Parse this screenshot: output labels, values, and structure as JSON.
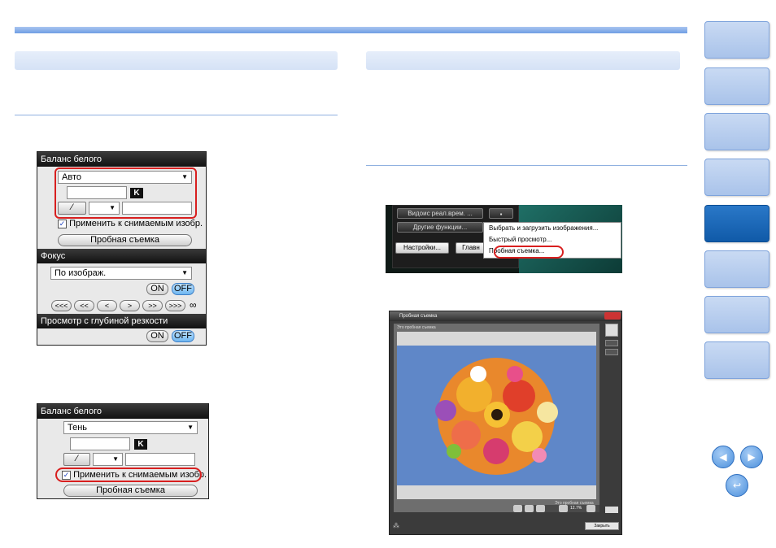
{
  "nav_tabs": [
    "",
    "",
    "",
    "",
    "",
    "",
    "",
    ""
  ],
  "panel1": {
    "wb_header": "Баланс белого",
    "wb_select": "Авто",
    "k_label": "K",
    "apply_label": "Применить к снимаемым изобр.",
    "test_shot": "Пробная съемка",
    "focus_header": "Фокус",
    "focus_select": "По изображ.",
    "on": "ON",
    "off": "OFF",
    "focus_nav": [
      "<<<",
      "<<",
      "<",
      ">",
      ">>",
      ">>>"
    ],
    "infinity": "∞",
    "dof_header": "Просмотр с глубиной резкости"
  },
  "panel2": {
    "wb_header": "Баланс белого",
    "wb_select": "Тень",
    "k_label": "K",
    "apply_label": "Применить к снимаемым изобр.",
    "test_shot": "Пробная съемка"
  },
  "menu_shot": {
    "btn_live_view": "Видоис реал.врем. ...",
    "btn_other": "Другие функции...",
    "btn_settings": "Настройки...",
    "btn_main": "Главн",
    "items": [
      "Выбрать и загрузить изображения...",
      "Быстрый просмотр...",
      "Пробная съемка..."
    ]
  },
  "test_window": {
    "title": "Пробная съемка",
    "caption_top": "Это пробная съемка",
    "caption_bottom": "Это пробная съемка",
    "zoom": "12.7%",
    "close_btn": "Закрыть"
  },
  "colors": {
    "accent": "#6f9ee4",
    "active_tab": "#105aa8",
    "highlight": "#d81f1f"
  }
}
